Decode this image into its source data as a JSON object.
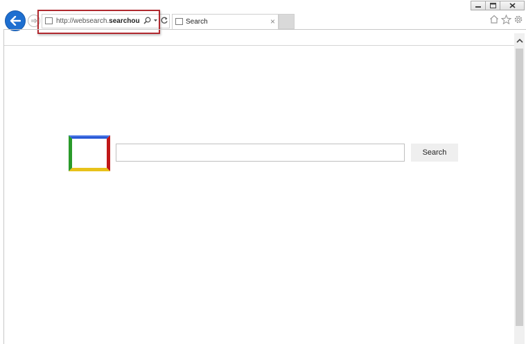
{
  "browser": {
    "address_url_prefix": "http://websearch.",
    "address_url_bold": "searchous...",
    "tab_label": "Search",
    "tab_close": "×"
  },
  "page": {
    "search_button_label": "Search",
    "search_input_value": ""
  },
  "colors": {
    "back_button": "#1e6fd0",
    "highlight_border": "#b0282e",
    "logo_blue": "#2a5ad6",
    "logo_red": "#c01818",
    "logo_yellow": "#e8c21a",
    "logo_green": "#2a9a2a"
  },
  "icons": [
    "back-arrow-icon",
    "forward-arrow-icon",
    "page-icon",
    "search-icon",
    "dropdown-icon",
    "refresh-icon",
    "tab-close-icon",
    "home-icon",
    "favorites-star-icon",
    "settings-gear-icon",
    "minimize-icon",
    "restore-icon",
    "close-icon",
    "scroll-up-icon"
  ]
}
